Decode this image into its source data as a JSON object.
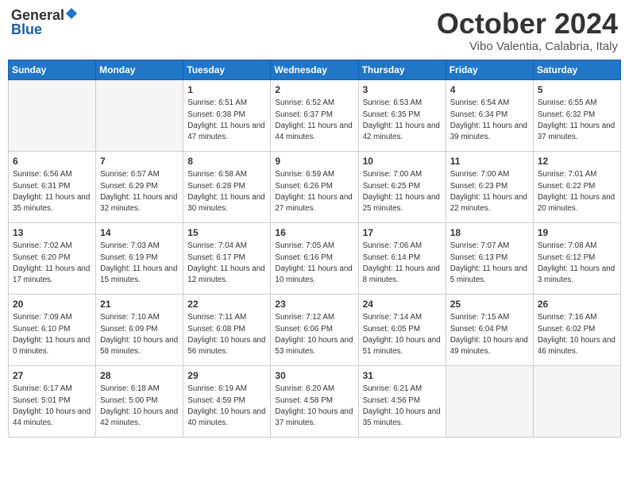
{
  "header": {
    "logo_general": "General",
    "logo_blue": "Blue",
    "month_title": "October 2024",
    "location": "Vibo Valentia, Calabria, Italy"
  },
  "weekdays": [
    "Sunday",
    "Monday",
    "Tuesday",
    "Wednesday",
    "Thursday",
    "Friday",
    "Saturday"
  ],
  "weeks": [
    [
      {
        "day": "",
        "info": ""
      },
      {
        "day": "",
        "info": ""
      },
      {
        "day": "1",
        "sunrise": "6:51 AM",
        "sunset": "6:38 PM",
        "daylight": "11 hours and 47 minutes."
      },
      {
        "day": "2",
        "sunrise": "6:52 AM",
        "sunset": "6:37 PM",
        "daylight": "11 hours and 44 minutes."
      },
      {
        "day": "3",
        "sunrise": "6:53 AM",
        "sunset": "6:35 PM",
        "daylight": "11 hours and 42 minutes."
      },
      {
        "day": "4",
        "sunrise": "6:54 AM",
        "sunset": "6:34 PM",
        "daylight": "11 hours and 39 minutes."
      },
      {
        "day": "5",
        "sunrise": "6:55 AM",
        "sunset": "6:32 PM",
        "daylight": "11 hours and 37 minutes."
      }
    ],
    [
      {
        "day": "6",
        "sunrise": "6:56 AM",
        "sunset": "6:31 PM",
        "daylight": "11 hours and 35 minutes."
      },
      {
        "day": "7",
        "sunrise": "6:57 AM",
        "sunset": "6:29 PM",
        "daylight": "11 hours and 32 minutes."
      },
      {
        "day": "8",
        "sunrise": "6:58 AM",
        "sunset": "6:28 PM",
        "daylight": "11 hours and 30 minutes."
      },
      {
        "day": "9",
        "sunrise": "6:59 AM",
        "sunset": "6:26 PM",
        "daylight": "11 hours and 27 minutes."
      },
      {
        "day": "10",
        "sunrise": "7:00 AM",
        "sunset": "6:25 PM",
        "daylight": "11 hours and 25 minutes."
      },
      {
        "day": "11",
        "sunrise": "7:00 AM",
        "sunset": "6:23 PM",
        "daylight": "11 hours and 22 minutes."
      },
      {
        "day": "12",
        "sunrise": "7:01 AM",
        "sunset": "6:22 PM",
        "daylight": "11 hours and 20 minutes."
      }
    ],
    [
      {
        "day": "13",
        "sunrise": "7:02 AM",
        "sunset": "6:20 PM",
        "daylight": "11 hours and 17 minutes."
      },
      {
        "day": "14",
        "sunrise": "7:03 AM",
        "sunset": "6:19 PM",
        "daylight": "11 hours and 15 minutes."
      },
      {
        "day": "15",
        "sunrise": "7:04 AM",
        "sunset": "6:17 PM",
        "daylight": "11 hours and 12 minutes."
      },
      {
        "day": "16",
        "sunrise": "7:05 AM",
        "sunset": "6:16 PM",
        "daylight": "11 hours and 10 minutes."
      },
      {
        "day": "17",
        "sunrise": "7:06 AM",
        "sunset": "6:14 PM",
        "daylight": "11 hours and 8 minutes."
      },
      {
        "day": "18",
        "sunrise": "7:07 AM",
        "sunset": "6:13 PM",
        "daylight": "11 hours and 5 minutes."
      },
      {
        "day": "19",
        "sunrise": "7:08 AM",
        "sunset": "6:12 PM",
        "daylight": "11 hours and 3 minutes."
      }
    ],
    [
      {
        "day": "20",
        "sunrise": "7:09 AM",
        "sunset": "6:10 PM",
        "daylight": "11 hours and 0 minutes."
      },
      {
        "day": "21",
        "sunrise": "7:10 AM",
        "sunset": "6:09 PM",
        "daylight": "10 hours and 58 minutes."
      },
      {
        "day": "22",
        "sunrise": "7:11 AM",
        "sunset": "6:08 PM",
        "daylight": "10 hours and 56 minutes."
      },
      {
        "day": "23",
        "sunrise": "7:12 AM",
        "sunset": "6:06 PM",
        "daylight": "10 hours and 53 minutes."
      },
      {
        "day": "24",
        "sunrise": "7:14 AM",
        "sunset": "6:05 PM",
        "daylight": "10 hours and 51 minutes."
      },
      {
        "day": "25",
        "sunrise": "7:15 AM",
        "sunset": "6:04 PM",
        "daylight": "10 hours and 49 minutes."
      },
      {
        "day": "26",
        "sunrise": "7:16 AM",
        "sunset": "6:02 PM",
        "daylight": "10 hours and 46 minutes."
      }
    ],
    [
      {
        "day": "27",
        "sunrise": "6:17 AM",
        "sunset": "5:01 PM",
        "daylight": "10 hours and 44 minutes."
      },
      {
        "day": "28",
        "sunrise": "6:18 AM",
        "sunset": "5:00 PM",
        "daylight": "10 hours and 42 minutes."
      },
      {
        "day": "29",
        "sunrise": "6:19 AM",
        "sunset": "4:59 PM",
        "daylight": "10 hours and 40 minutes."
      },
      {
        "day": "30",
        "sunrise": "6:20 AM",
        "sunset": "4:58 PM",
        "daylight": "10 hours and 37 minutes."
      },
      {
        "day": "31",
        "sunrise": "6:21 AM",
        "sunset": "4:56 PM",
        "daylight": "10 hours and 35 minutes."
      },
      {
        "day": "",
        "info": ""
      },
      {
        "day": "",
        "info": ""
      }
    ]
  ]
}
